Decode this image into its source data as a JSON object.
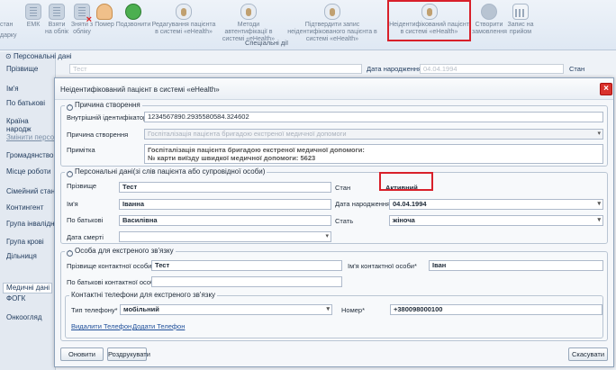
{
  "ribbon": {
    "left_cut": [
      "стан",
      "дарку"
    ],
    "buttons": [
      {
        "label": "ЕМК",
        "icon": "emk-icon"
      },
      {
        "label": "Взяти на облік",
        "icon": "register-icon"
      },
      {
        "label": "Зняти з обліку",
        "icon": "deregister-icon"
      },
      {
        "label": "Помер",
        "icon": "deceased-icon"
      },
      {
        "label": "Подзвонити",
        "icon": "phone-icon"
      },
      {
        "label": "Редагування пацієнта в системі «eHealth»",
        "icon": "edit-patient-icon"
      },
      {
        "label": "Методи автентифікації в системі «eHealth»",
        "icon": "auth-methods-icon"
      },
      {
        "label": "Підтвердити запис неідентифікованого пацієнта в системі «eHealth»",
        "icon": "confirm-record-icon"
      },
      {
        "label": "Неідентифікований пацієнт в системі «eHealth»",
        "icon": "unidentified-patient-icon"
      },
      {
        "label": "Створити замовлення",
        "icon": "create-order-icon"
      },
      {
        "label": "Запис на прийом",
        "icon": "appointment-icon"
      }
    ],
    "group_label": "Спеціальні дії"
  },
  "background": {
    "section": "Персональні дані",
    "left_labels": [
      "Прізвище",
      "Ім'я",
      "По батькові",
      "Країна народж",
      "Змінити персо",
      "Громадянство",
      "Місце роботи",
      "Сімейний стан",
      "Контингент",
      "Група інвалідн",
      "Група крові",
      "Дільниця"
    ],
    "surname_value": "Тест",
    "dob_label": "Дата народження",
    "dob_value": "04.04.1994",
    "state_label": "Стан",
    "med_tab": "Медичні дані",
    "bottom_labels": [
      "ФОГК",
      "Онкоогляд"
    ]
  },
  "dialog": {
    "title": "Неідентифікований пацієнт в системі «eHealth»",
    "reason": {
      "legend": "Причина створення",
      "internal_id_label": "Внутрішній ідентифікатор",
      "internal_id_value": "1234567890.2935580584.324602",
      "reason_label": "Причина створення",
      "reason_value": "Госпіталізація пацієнта бригадою екстреної медичної допомоги",
      "note_label": "Примітка",
      "note_value_line1": "Госпіталізація пацієнта бригадою екстреної медичної допомоги:",
      "note_value_line2": "№ карти виїзду швидкої медичної допомоги: 5623"
    },
    "personal": {
      "legend": "Персональні дані(зі слів пацієнта або супровідної особи)",
      "surname_label": "Прізвище",
      "surname_value": "Тест",
      "name_label": "Ім'я",
      "name_value": "Іванна",
      "patronymic_label": "По батькові",
      "patronymic_value": "Василівна",
      "death_label": "Дата смерті",
      "death_value": "",
      "state_label": "Стан",
      "state_value": "Активний",
      "dob_label": "Дата народження",
      "dob_value": "04.04.1994",
      "sex_label": "Стать",
      "sex_value": "жіноча"
    },
    "emergency": {
      "legend": "Особа для екстреного зв'язку",
      "surname_label": "Прізвище контактної особи*",
      "surname_value": "Тест",
      "name_label": "Ім'я контактної особи*",
      "name_value": "Іван",
      "patronymic_label": "По батькові контактної особи",
      "patronymic_value": "",
      "phones": {
        "legend": "Контактні телефони для екстреного зв'язку",
        "type_label": "Тип телефону*",
        "type_value": "мобільний",
        "number_label": "Номер*",
        "number_value": "+380098000100",
        "delete_link": "Видалити Телефон",
        "add_link": "Додати Телефон"
      }
    },
    "buttons": {
      "update": "Оновити",
      "print": "Роздрукувати",
      "cancel": "Скасувати"
    }
  },
  "colors": {
    "highlight": "#d8202a",
    "accent": "#1f3a5c",
    "close": "#d9322c"
  }
}
